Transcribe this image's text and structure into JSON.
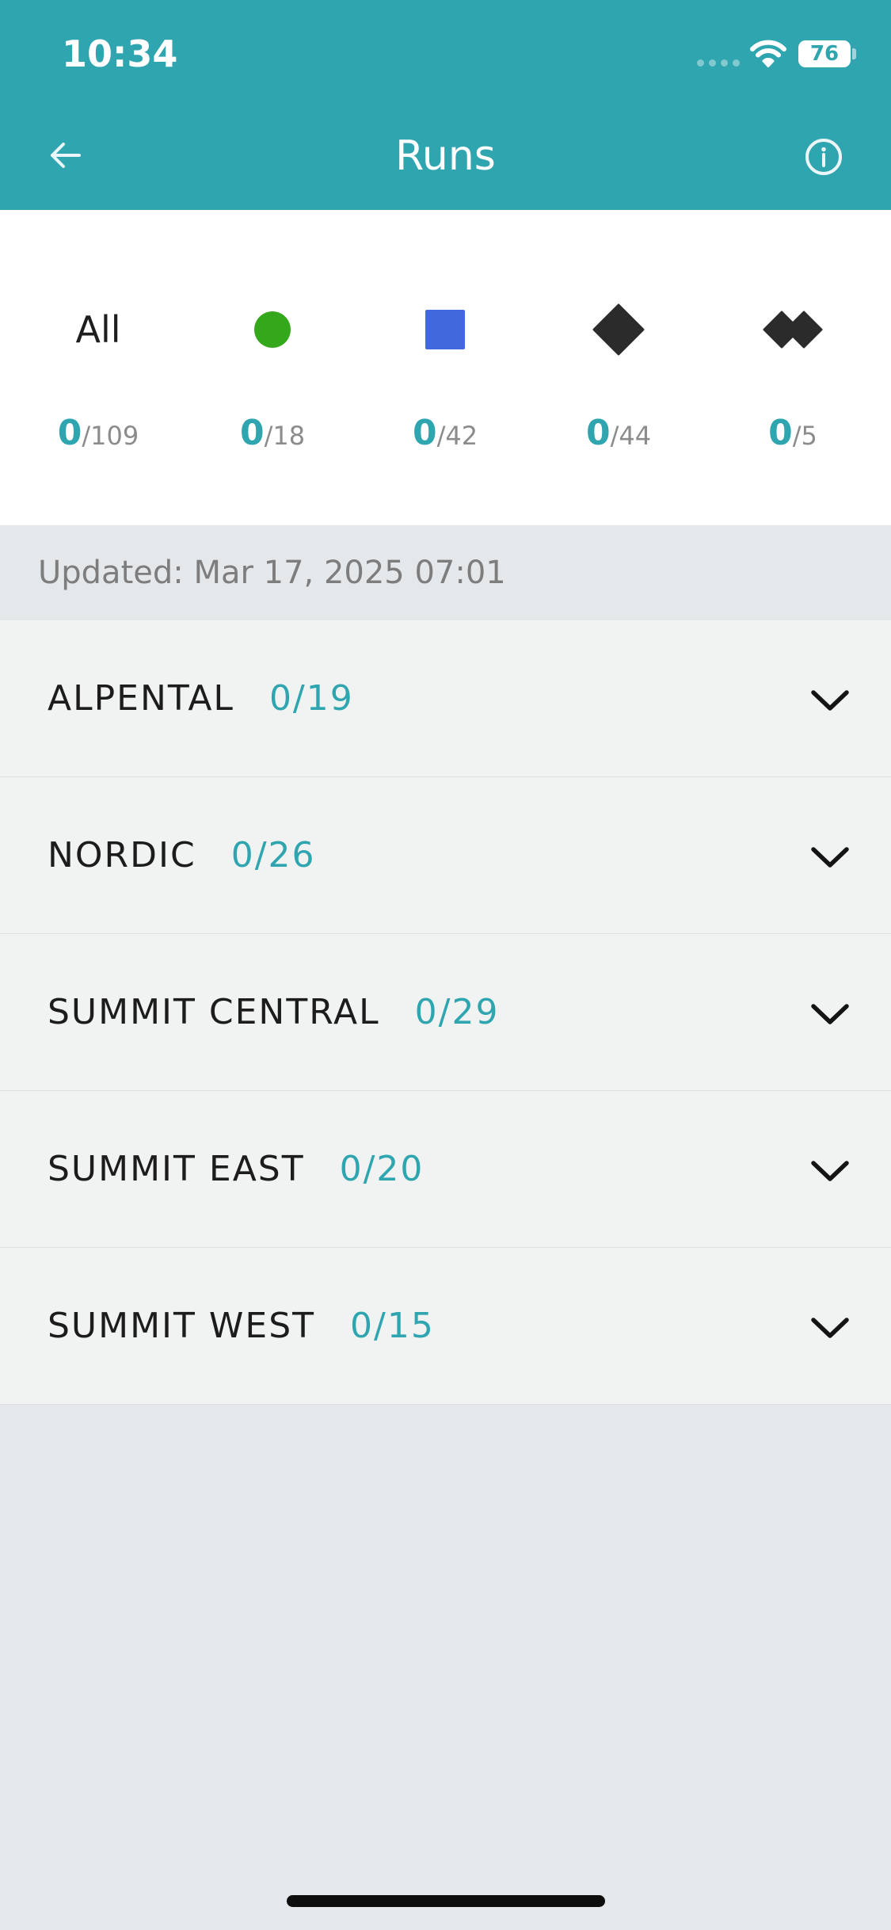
{
  "status_bar": {
    "time": "10:34",
    "battery_level": "76",
    "wifi_icon": "wifi-icon",
    "cellular_icon": "cellular-signal-icon"
  },
  "header": {
    "title": "Runs",
    "back_icon": "back-arrow-icon",
    "info_icon": "info-icon",
    "background_color": "#2ea5af"
  },
  "difficulties": [
    {
      "label": "All",
      "icon": "none",
      "completed": "0",
      "total": "/109"
    },
    {
      "label": "",
      "icon": "green-circle-icon",
      "color": "#34a81a",
      "completed": "0",
      "total": "/18"
    },
    {
      "label": "",
      "icon": "blue-square-icon",
      "color": "#4168dc",
      "completed": "0",
      "total": "/42"
    },
    {
      "label": "",
      "icon": "black-diamond-icon",
      "color": "#2b2b2b",
      "completed": "0",
      "total": "/44"
    },
    {
      "label": "",
      "icon": "double-black-diamond-icon",
      "color": "#2b2b2b",
      "completed": "0",
      "total": "/5"
    }
  ],
  "updated": {
    "text": "Updated: Mar 17, 2025 07:01"
  },
  "areas": [
    {
      "name": "ALPENTAL",
      "count": "0/19"
    },
    {
      "name": "NORDIC",
      "count": "0/26"
    },
    {
      "name": "SUMMIT CENTRAL",
      "count": "0/29"
    },
    {
      "name": "SUMMIT EAST",
      "count": "0/20"
    },
    {
      "name": "SUMMIT WEST",
      "count": "0/15"
    }
  ],
  "colors": {
    "accent": "#2ea5af",
    "muted_text": "#8c8c8c",
    "page_background": "#e4e8ea",
    "row_background": "#f1f3f3"
  }
}
